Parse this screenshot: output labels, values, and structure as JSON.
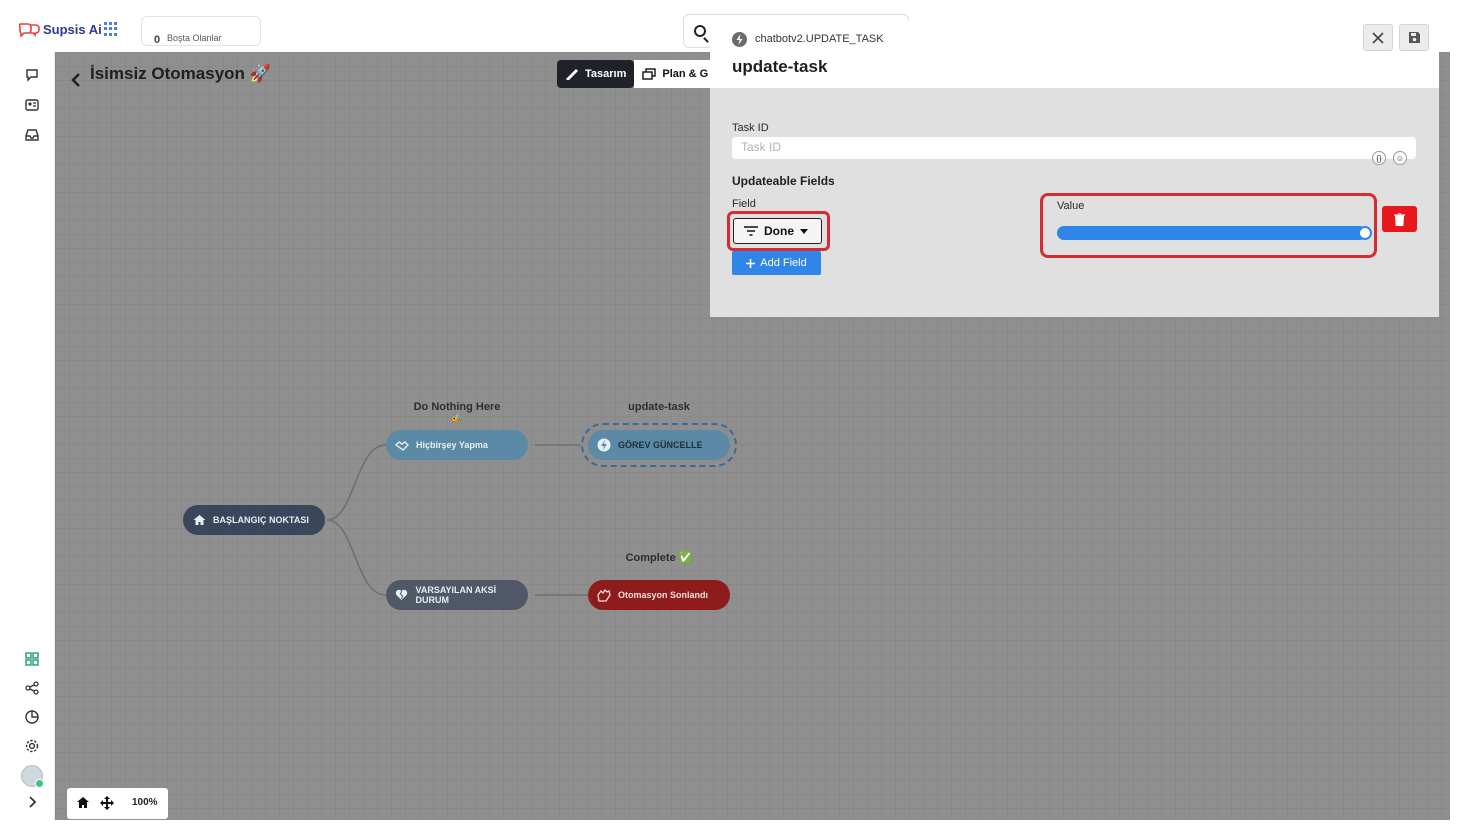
{
  "topbar": {
    "brand": "Supsis Ai",
    "idle_count": "0",
    "idle_label": "Boşta Olanlar"
  },
  "automation": {
    "title": "İsimsiz Otomasyon 🚀",
    "tabs": [
      {
        "label": "Tasarım",
        "active": true
      },
      {
        "label": "Plan & G",
        "active": false
      }
    ]
  },
  "flow": {
    "nodes": {
      "start": {
        "label": "BAŞLANGIÇ NOKTASI",
        "icon": "home-icon"
      },
      "nothing": {
        "label": "Hiçbirşey Yapma",
        "icon": "handshake-icon",
        "caption": "Do Nothing Here",
        "caption_emoji": "🐝"
      },
      "default": {
        "label": "VARSAYILAN AKSİ DURUM",
        "icon": "broken-heart-icon"
      },
      "update": {
        "label": "GÖREV GÜNCELLE",
        "icon": "bolt-icon",
        "caption": "update-task"
      },
      "end": {
        "label": "Otomasyon Sonlandı",
        "icon": "waving-hand-icon",
        "caption": "Complete ✅"
      }
    },
    "zoom": "100%"
  },
  "panel": {
    "type": "chatbotv2.UPDATE_TASK",
    "title": "update-task",
    "task_id_label": "Task ID",
    "task_id_placeholder": "Task ID",
    "section_title": "Updateable Fields",
    "field_label": "Field",
    "field_value": "Done",
    "value_label": "Value",
    "value_toggle": 1,
    "add_field": "Add Field",
    "mini_icons": [
      "code-braces-icon",
      "emoji-icon"
    ]
  },
  "colors": {
    "accent": "#2f86e8",
    "danger": "#e8161d",
    "highlight": "#d62b33",
    "canvas": "#8f8f8f",
    "brand": "#2d3b8f"
  }
}
